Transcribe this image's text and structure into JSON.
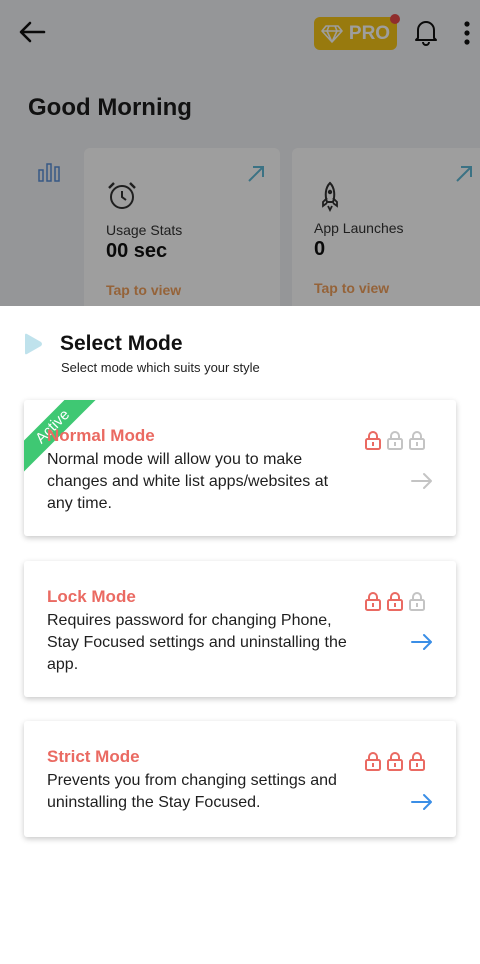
{
  "header": {
    "pro_label": "PRO",
    "greeting": "Good Morning"
  },
  "stats": [
    {
      "label": "Usage Stats",
      "value": "00 sec",
      "action": "Tap to view"
    },
    {
      "label": "App Launches",
      "value": "0",
      "action": "Tap to view"
    }
  ],
  "sheet": {
    "title": "Select Mode",
    "subtitle": "Select mode which suits your style"
  },
  "modes": [
    {
      "title": "Normal Mode",
      "description": "Normal mode will allow you to make changes and white list apps/websites at any time.",
      "badge": "Active",
      "lock_level": 1
    },
    {
      "title": "Lock Mode",
      "description": "Requires password for changing Phone, Stay Focused settings and uninstalling the app.",
      "lock_level": 2
    },
    {
      "title": "Strict Mode",
      "description": "Prevents you from changing settings and uninstalling the Stay Focused.",
      "lock_level": 3
    }
  ],
  "colors": {
    "accent_red": "#ea6a62",
    "active_green": "#3fc873",
    "arrow_blue": "#3a8ee6",
    "pro_yellow": "#f5c518"
  }
}
